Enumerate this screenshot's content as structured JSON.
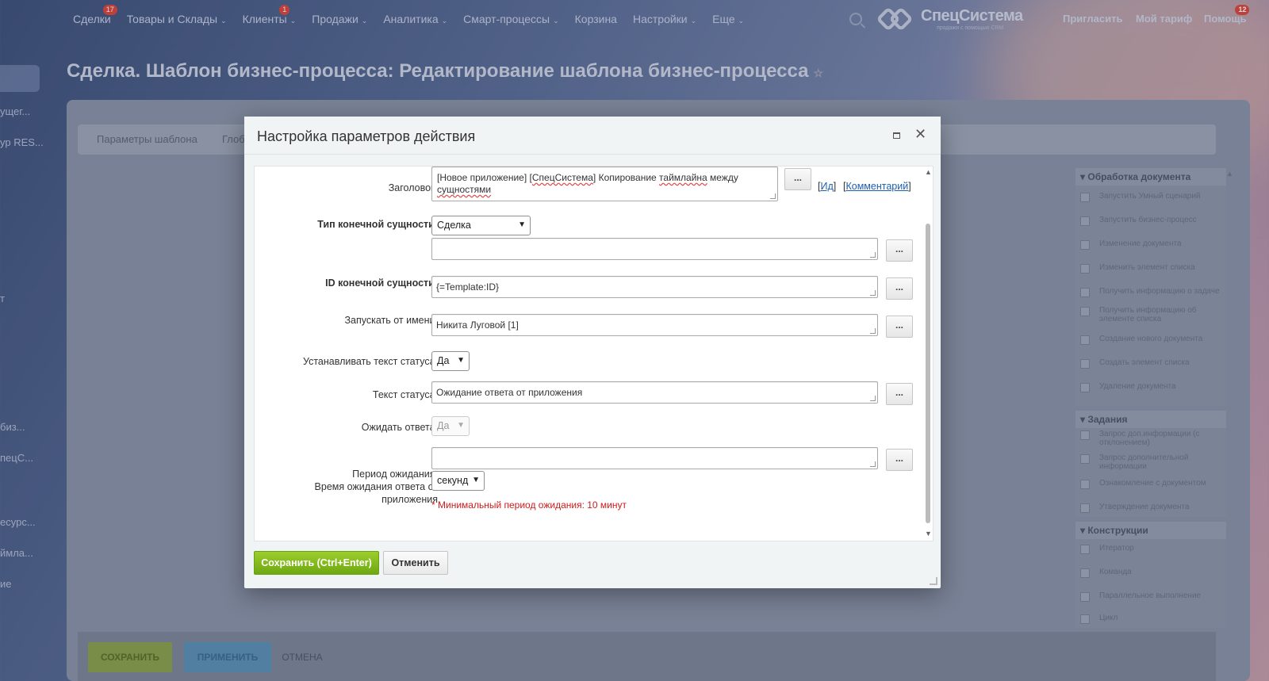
{
  "topnav": {
    "items": [
      {
        "label": "Сделки",
        "badge": "17"
      },
      {
        "label": "Товары и Склады",
        "chevron": "⌄"
      },
      {
        "label": "Клиенты",
        "chevron": "⌄",
        "badge": "1"
      },
      {
        "label": "Продажи",
        "chevron": "⌄"
      },
      {
        "label": "Аналитика",
        "chevron": "⌄"
      },
      {
        "label": "Смарт-процессы",
        "chevron": "⌄"
      },
      {
        "label": "Корзина"
      },
      {
        "label": "Настройки",
        "chevron": "⌄"
      },
      {
        "label": "Еще",
        "chevron": "⌄"
      }
    ],
    "brand_name": "СпецСистема",
    "brand_tagline": "продажи с помощью CRM",
    "invite": "Пригласить",
    "tariff": "Мой тариф",
    "help": "Помощь",
    "help_badge": "12"
  },
  "page": {
    "title": "Сделка. Шаблон бизнес-процесса: Редактирование шаблона бизнес-процесса",
    "star": "☆",
    "tabs": [
      "Параметры шаблона",
      "Глоб"
    ],
    "save": "Сохранить",
    "apply": "Применить",
    "cancel": "Отмена"
  },
  "left_strip": [
    "ущег...",
    "ур RES...",
    "т",
    "биз...",
    "пецС...",
    "есурс...",
    "ймла...",
    "ие"
  ],
  "right_panel": {
    "groups": [
      {
        "title": "Обработка документа",
        "items": [
          "Запустить Умный сценарий",
          "Запустить бизнес-процесс",
          "Изменение документа",
          "Изменить элемент списка",
          "Получить информацию о задаче",
          "Получить информацию об элементе списка",
          "Создание нового документа",
          "Создать элемент списка",
          "Удаление документа"
        ]
      },
      {
        "title": "Задания",
        "items": [
          "Запрос доп.информации (с отклонением)",
          "Запрос дополнительной информации",
          "Ознакомление с документом",
          "Утверждение документа"
        ]
      },
      {
        "title": "Конструкции",
        "items": [
          "Итератор",
          "Команда",
          "Параллельное выполнение",
          "Цикл"
        ]
      }
    ]
  },
  "modal": {
    "title": "Настройка параметров действия",
    "fields": {
      "title_label": "Заголовок:",
      "title_value_1": "[Новое приложение] [",
      "title_value_brand": "СпецСистема",
      "title_value_2": "] Копирование ",
      "title_value_wavy": "таймлайна",
      "title_value_3": " между",
      "title_value_line2": "сущностями",
      "id_link": "Ид",
      "comment_link": "Комментарий",
      "entity_type_label": "Тип конечной сущности:",
      "entity_type_value": "Сделка",
      "entity_type_text": "",
      "entity_id_label": "ID конечной сущности:",
      "entity_id_value": "{=Template:ID}",
      "run_as_label": "Запускать от имени:",
      "run_as_value": "Никита Луговой [1]",
      "set_status_label": "Устанавливать текст статуса:",
      "set_status_value": "Да",
      "status_text_label": "Текст статуса:",
      "status_text_value": "Ожидание ответа от приложения",
      "wait_label": "Ожидать ответа:",
      "wait_value": "Да",
      "period_label_1": "Период ожидания:",
      "period_label_2": "Время ожидания ответа от",
      "period_label_3": "приложения",
      "period_value": "",
      "period_unit": "секунд",
      "period_hint": "* Минимальный период ожидания: 10 минут"
    },
    "dots": "...",
    "save_button": "Сохранить (Ctrl+Enter)",
    "cancel_button": "Отменить"
  },
  "colors": {
    "accent_green": "#7cb518",
    "link_blue": "#1d5fb0",
    "hint_red": "#d01a1a"
  },
  "icons": [
    "search-icon",
    "close-icon",
    "maximize-icon",
    "chevron-down-icon",
    "star-icon"
  ]
}
